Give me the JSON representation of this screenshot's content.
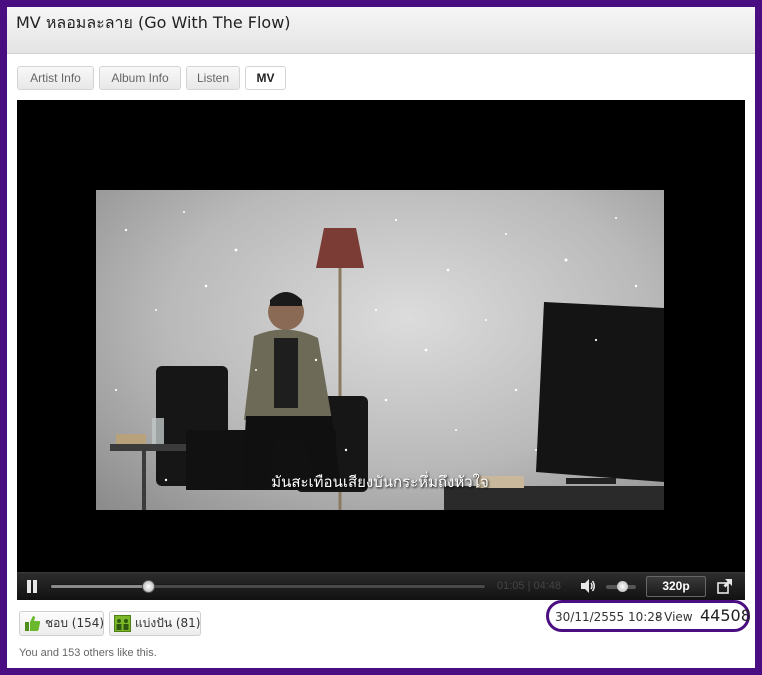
{
  "title": "MV หลอมละลาย (Go With The Flow)",
  "tabs": [
    {
      "label": "Artist Info",
      "active": false
    },
    {
      "label": "Album Info",
      "active": false
    },
    {
      "label": "Listen",
      "active": false
    },
    {
      "label": "MV",
      "active": true
    }
  ],
  "player": {
    "subtitle": "มันสะเทือนเสียงบันกระหึ่มถึงหัวใจ",
    "elapsed": "01:05",
    "duration": "04:48",
    "time_separator": " | ",
    "progress_fraction": 0.226,
    "volume_fraction": 0.55,
    "quality": "320p"
  },
  "social": {
    "like_label": "ชอบ (154)",
    "share_label": "แบ่งปัน (81)",
    "likes_text": "You and 153 others like this."
  },
  "meta": {
    "date": "30/11/2555 10:28",
    "view_label": "- View",
    "view_count": "44508"
  },
  "colors": {
    "background": "#4b0d82",
    "highlight_ring": "#4b0d82",
    "player_bg": "#000000",
    "like_icon": "#6ab82e",
    "share_icon": "#7bb82a"
  },
  "icons": [
    "pause-icon",
    "volume-icon",
    "fullscreen-icon",
    "thumbs-up-icon",
    "share-icon"
  ]
}
